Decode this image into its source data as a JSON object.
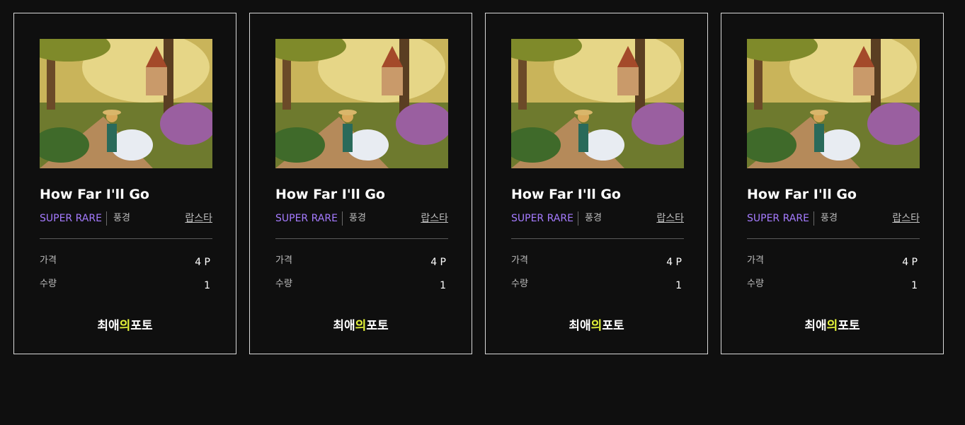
{
  "cards": [
    {
      "title": "How Far I'll Go",
      "grade": "SUPER RARE",
      "category": "풍경",
      "creator": "랍스타",
      "price_label": "가격",
      "price_value": "4 P",
      "qty_label": "수량",
      "qty_value": "1",
      "brand_pre": "최애",
      "brand_hl": "의",
      "brand_post": "포토"
    },
    {
      "title": "How Far I'll Go",
      "grade": "SUPER RARE",
      "category": "풍경",
      "creator": "랍스타",
      "price_label": "가격",
      "price_value": "4 P",
      "qty_label": "수량",
      "qty_value": "1",
      "brand_pre": "최애",
      "brand_hl": "의",
      "brand_post": "포토"
    },
    {
      "title": "How Far I'll Go",
      "grade": "SUPER RARE",
      "category": "풍경",
      "creator": "랍스타",
      "price_label": "가격",
      "price_value": "4 P",
      "qty_label": "수량",
      "qty_value": "1",
      "brand_pre": "최애",
      "brand_hl": "의",
      "brand_post": "포토"
    },
    {
      "title": "How Far I'll Go",
      "grade": "SUPER RARE",
      "category": "풍경",
      "creator": "랍스타",
      "price_label": "가격",
      "price_value": "4 P",
      "qty_label": "수량",
      "qty_value": "1",
      "brand_pre": "최애",
      "brand_hl": "의",
      "brand_post": "포토"
    }
  ],
  "colors": {
    "background": "#0f0f0f",
    "grade": "#a57bff",
    "brand_highlight": "#e6f53a"
  }
}
